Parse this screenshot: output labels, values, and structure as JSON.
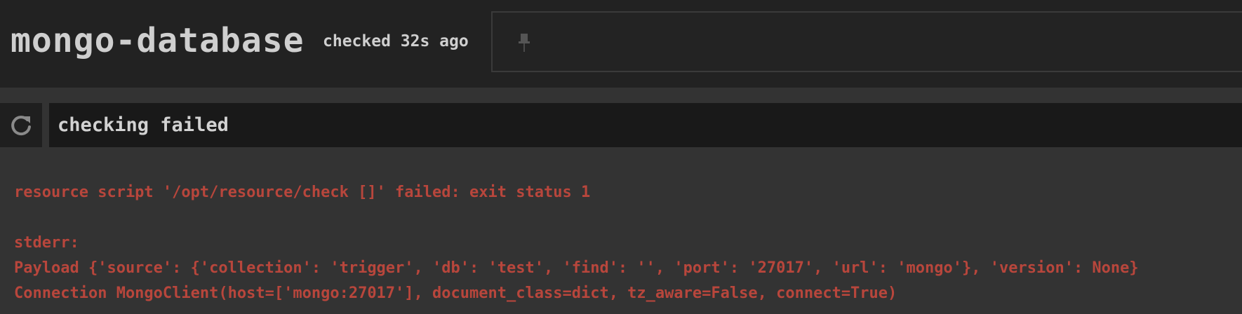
{
  "header": {
    "title": "mongo-database",
    "checked": "checked 32s ago"
  },
  "status": {
    "text": "checking failed"
  },
  "log": {
    "lines": [
      "resource script '/opt/resource/check []' failed: exit status 1",
      "",
      "stderr:",
      "Payload {'source': {'collection': 'trigger', 'db': 'test', 'find': '', 'port': '27017', 'url': 'mongo'}, 'version': None}",
      "Connection MongoClient(host=['mongo:27017'], document_class=dict, tz_aware=False, connect=True)"
    ]
  },
  "colors": {
    "header_bg": "#222222",
    "page_bg": "#333333",
    "status_bg": "#191919",
    "error_text": "#b8463c"
  },
  "icons": {
    "pin": "pin-icon",
    "refresh": "refresh-icon"
  }
}
